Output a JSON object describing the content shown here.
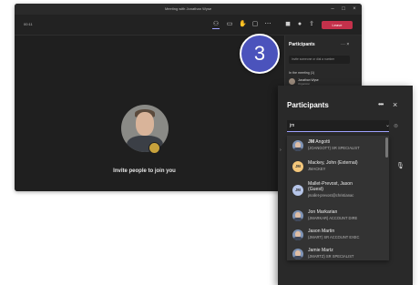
{
  "window": {
    "title": "Meeting with Jonathan Wyse"
  },
  "toolbar": {
    "timer": "00:11",
    "leave_label": "Leave"
  },
  "colors": {
    "accent": "#9ea2ff",
    "leave": "#c4314b",
    "badge": "#4b53bc"
  },
  "stage": {
    "invite_text": "Invite people to join you"
  },
  "side_panel": {
    "title": "Participants",
    "search_placeholder": "Invite someone or dial a number",
    "section": "In the meeting (1)",
    "user_name": "Jonathan Wyse",
    "user_role": "Organizer"
  },
  "step_badge": "3",
  "panel": {
    "title": "Participants",
    "search_value": "jm",
    "results": [
      {
        "name_bold": "JM",
        "name_rest": " Angotti",
        "sub": "(JOANGOTT) SR SPECIALIST",
        "avatar": "photo",
        "initials": ""
      },
      {
        "name_bold": "",
        "name_rest": "Mackey, John (External)",
        "sub": "JMACKEY",
        "avatar": "initials",
        "initials": "JM",
        "bg": "#f4c77b"
      },
      {
        "name_bold": "",
        "name_rest": "Mallet-Prevost, Jason",
        "name_rest2": "(Guest)",
        "sub": "jmallet-prevost@christianac",
        "avatar": "initials",
        "initials": "JM",
        "bg": "#b6c5e8"
      },
      {
        "name_bold": "",
        "name_rest": "Jon Markarian",
        "sub": "(JMARKAR) ACCOUNT DIRE",
        "avatar": "photo",
        "initials": ""
      },
      {
        "name_bold": "",
        "name_rest": "Jason Martin",
        "sub": "(JMART) SR ACCOUNT EXEC",
        "avatar": "photo",
        "initials": ""
      },
      {
        "name_bold": "",
        "name_rest": "Jamie Martz",
        "sub": "(JMARTZ) SR SPECIALIST",
        "avatar": "photo",
        "initials": ""
      }
    ]
  }
}
